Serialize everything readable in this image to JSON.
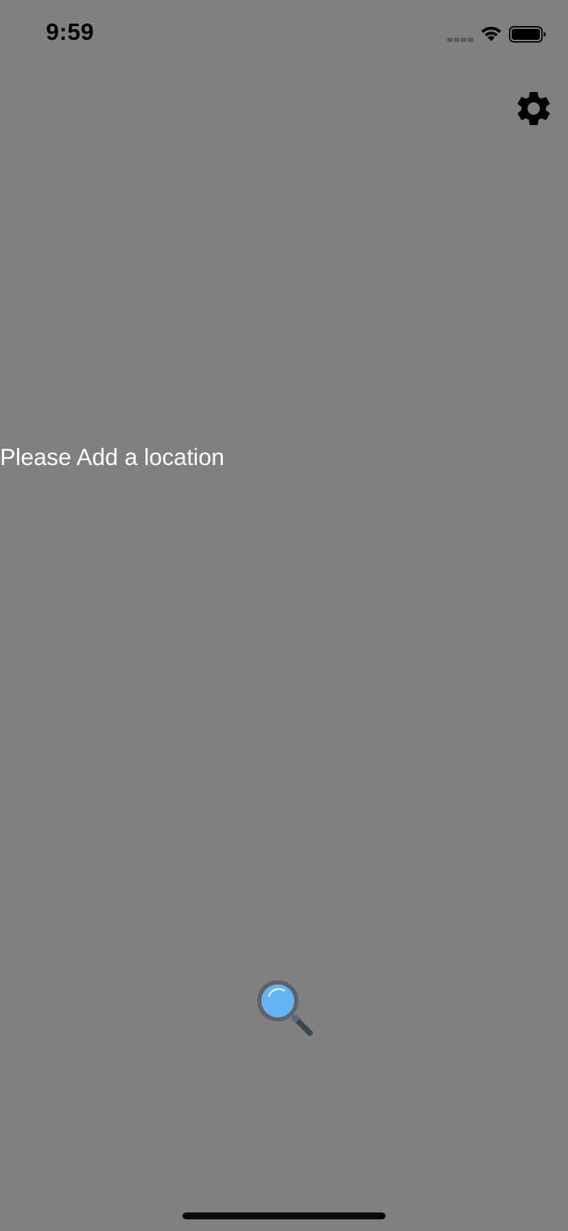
{
  "status_bar": {
    "time": "9:59",
    "signal_icon": "signal-dots-icon",
    "wifi_icon": "wifi-icon",
    "battery_icon": "battery-full-icon"
  },
  "header": {
    "settings_icon": "gear-icon"
  },
  "main": {
    "empty_message": "Please Add a location"
  },
  "footer": {
    "search_icon": "magnifying-glass-icon"
  },
  "colors": {
    "background": "#808080",
    "text": "#ffffff",
    "icon_dark": "#000000",
    "search_lens": "#64b5f6"
  }
}
